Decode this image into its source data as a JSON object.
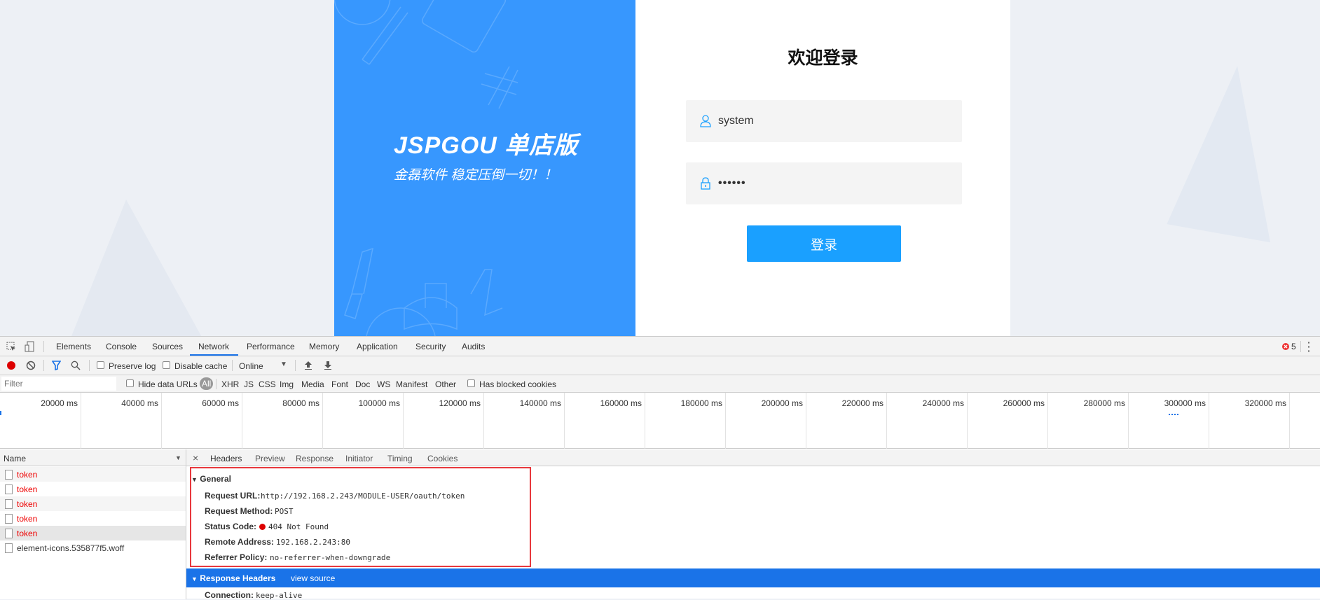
{
  "login": {
    "brand": "JSPGOU 单店版",
    "slogan": "金磊软件 稳定压倒一切！！",
    "title": "欢迎登录",
    "username_value": "system",
    "password_value": "••••••",
    "login_button": "登录",
    "brand_color": "#3797fe",
    "button_color": "#1aa0ff"
  },
  "devtools": {
    "tabs": [
      "Elements",
      "Console",
      "Sources",
      "Network",
      "Performance",
      "Memory",
      "Application",
      "Security",
      "Audits"
    ],
    "active_tab": "Network",
    "error_count": "5",
    "toolbar": {
      "preserve_log": "Preserve log",
      "disable_cache": "Disable cache",
      "throttle": "Online"
    },
    "filter": {
      "placeholder": "Filter",
      "hide_data_urls": "Hide data URLs",
      "types": [
        "All",
        "XHR",
        "JS",
        "CSS",
        "Img",
        "Media",
        "Font",
        "Doc",
        "WS",
        "Manifest",
        "Other"
      ],
      "has_blocked_cookies": "Has blocked cookies"
    },
    "timeline_ticks": [
      "20000 ms",
      "40000 ms",
      "60000 ms",
      "80000 ms",
      "100000 ms",
      "120000 ms",
      "140000 ms",
      "160000 ms",
      "180000 ms",
      "200000 ms",
      "220000 ms",
      "240000 ms",
      "260000 ms",
      "280000 ms",
      "300000 ms",
      "320000 ms"
    ],
    "name_header": "Name",
    "requests": [
      {
        "name": "token",
        "error": true
      },
      {
        "name": "token",
        "error": true
      },
      {
        "name": "token",
        "error": true
      },
      {
        "name": "token",
        "error": true
      },
      {
        "name": "token",
        "error": true
      },
      {
        "name": "element-icons.535877f5.woff",
        "error": false
      }
    ],
    "detail_tabs": [
      "Headers",
      "Preview",
      "Response",
      "Initiator",
      "Timing",
      "Cookies"
    ],
    "general": {
      "title": "General",
      "fields": [
        {
          "label": "Request URL:",
          "value": "http://192.168.2.243/MODULE-USER/oauth/token"
        },
        {
          "label": "Request Method:",
          "value": "POST"
        },
        {
          "label": "Status Code:",
          "value": "404 Not Found"
        },
        {
          "label": "Remote Address:",
          "value": "192.168.2.243:80"
        },
        {
          "label": "Referrer Policy:",
          "value": "no-referrer-when-downgrade"
        }
      ]
    },
    "response_headers": {
      "title": "Response Headers",
      "view_source": "view source",
      "first_label": "Connection:",
      "first_value": "keep-alive"
    }
  }
}
